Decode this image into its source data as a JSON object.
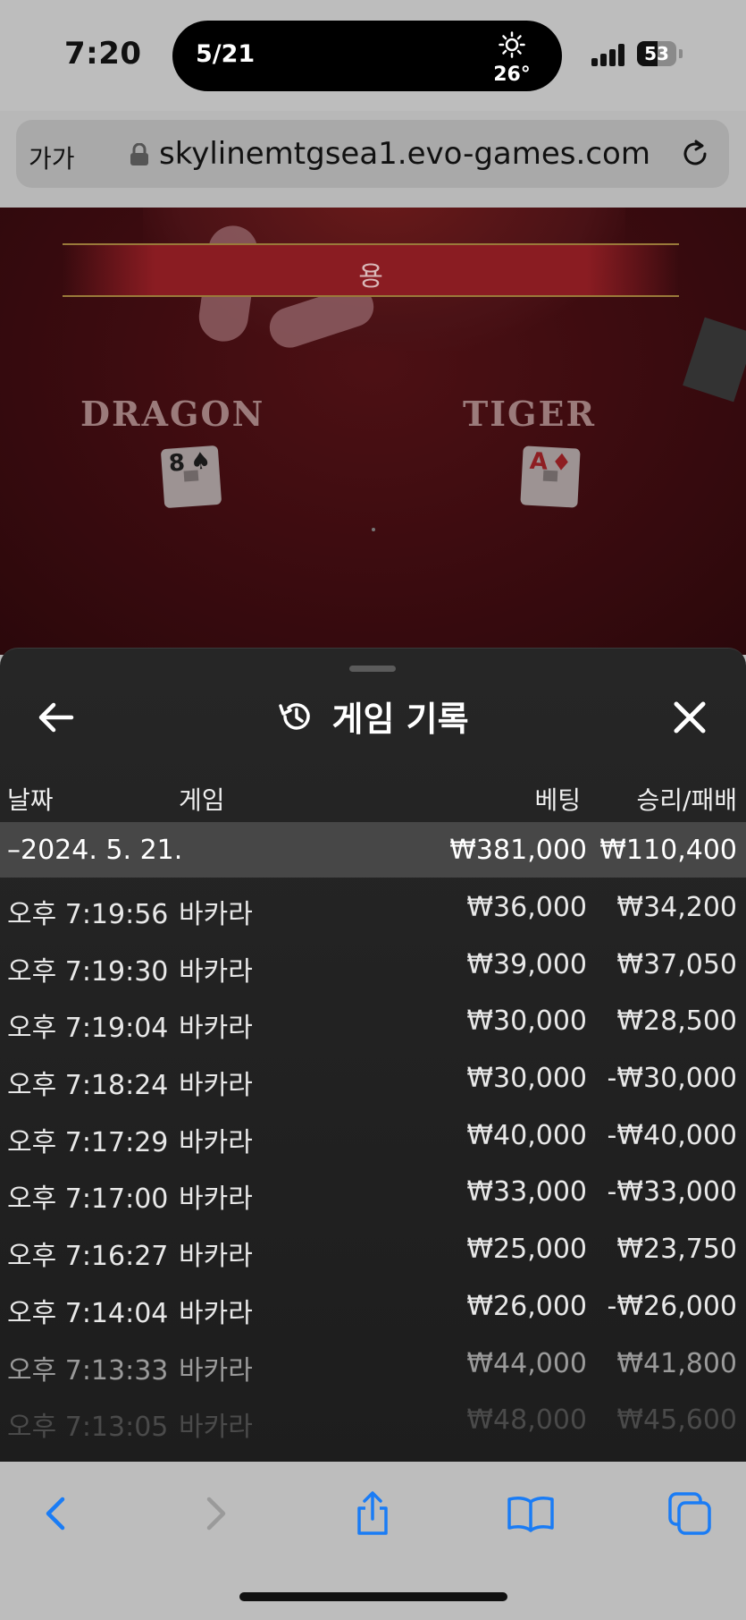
{
  "status_bar": {
    "time": "7:20",
    "island_date": "5/21",
    "weather_icon": "sun-icon",
    "temperature": "26°",
    "battery_level": "53",
    "battery_percent": 53
  },
  "url_bar": {
    "reader_label": "가가",
    "url": "skylinemtgsea1.evo-games.com"
  },
  "game_view": {
    "result_banner": "용",
    "dragon_label": "DRAGON",
    "tiger_label": "TIGER",
    "dragon_card": {
      "rank": "8",
      "suit": "♠"
    },
    "tiger_card": {
      "rank": "A",
      "suit": "♦"
    }
  },
  "history_panel": {
    "title": "게임 기록",
    "columns": {
      "date": "날짜",
      "game": "게임",
      "bet": "베팅",
      "win_loss": "승리/패배"
    },
    "group": {
      "date": "–2024. 5. 21.",
      "bet": "₩381,000",
      "win_loss": "₩110,400"
    },
    "rows": [
      {
        "time": "오후 7:19:56",
        "game": "바카라",
        "bet": "₩36,000",
        "win_loss": "₩34,200"
      },
      {
        "time": "오후 7:19:30",
        "game": "바카라",
        "bet": "₩39,000",
        "win_loss": "₩37,050"
      },
      {
        "time": "오후 7:19:04",
        "game": "바카라",
        "bet": "₩30,000",
        "win_loss": "₩28,500"
      },
      {
        "time": "오후 7:18:24",
        "game": "바카라",
        "bet": "₩30,000",
        "win_loss": "-₩30,000"
      },
      {
        "time": "오후 7:17:29",
        "game": "바카라",
        "bet": "₩40,000",
        "win_loss": "-₩40,000"
      },
      {
        "time": "오후 7:17:00",
        "game": "바카라",
        "bet": "₩33,000",
        "win_loss": "-₩33,000"
      },
      {
        "time": "오후 7:16:27",
        "game": "바카라",
        "bet": "₩25,000",
        "win_loss": "₩23,750"
      },
      {
        "time": "오후 7:14:04",
        "game": "바카라",
        "bet": "₩26,000",
        "win_loss": "-₩26,000"
      },
      {
        "time": "오후 7:13:33",
        "game": "바카라",
        "bet": "₩44,000",
        "win_loss": "₩41,800"
      },
      {
        "time": "오후 7:13:05",
        "game": "바카라",
        "bet": "₩48,000",
        "win_loss": "₩45,600"
      }
    ]
  },
  "toolbar": {
    "icons": [
      "back-icon",
      "forward-icon",
      "share-icon",
      "bookmarks-icon",
      "tabs-icon"
    ],
    "accent_color": "#1a7cf5"
  }
}
